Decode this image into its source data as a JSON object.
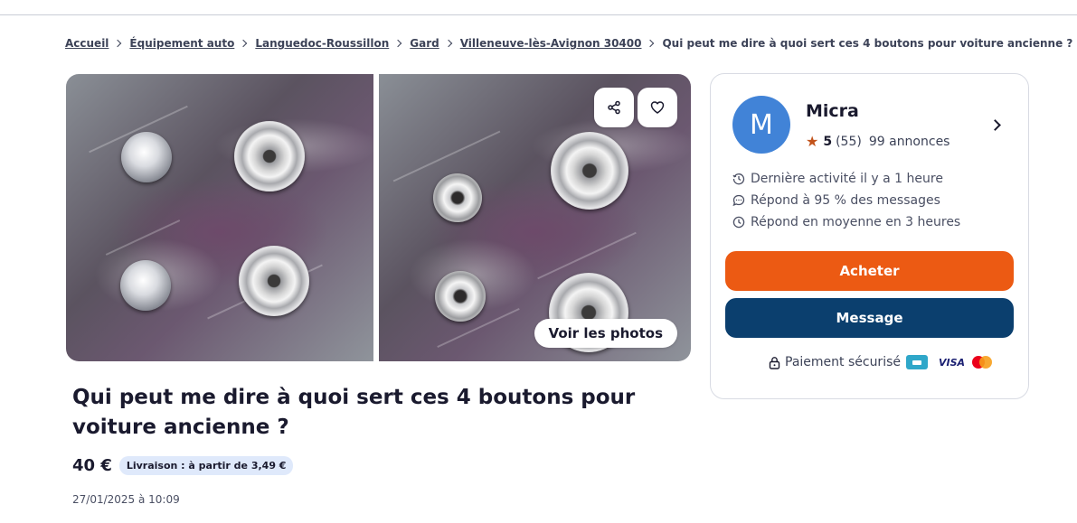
{
  "breadcrumb": {
    "items": [
      "Accueil",
      "Équipement auto",
      "Languedoc-Roussillon",
      "Gard",
      "Villeneuve-lès-Avignon 30400"
    ],
    "current": "Qui peut me dire à quoi sert ces 4 boutons pour voiture ancienne ?"
  },
  "gallery": {
    "see_photos_label": "Voir les photos",
    "share_icon": "share-icon",
    "favorite_icon": "heart-icon"
  },
  "listing": {
    "title": "Qui peut me dire à quoi sert ces 4 boutons pour voiture ancienne ?",
    "price": "40 €",
    "delivery": "Livraison : à partir de 3,49 €",
    "date": "27/01/2025 à 10:09"
  },
  "seller": {
    "avatar_letter": "M",
    "name": "Micra",
    "rating": "5",
    "reviews": "(55)",
    "listings": "99 annonces",
    "last_activity": "Dernière activité il y a 1 heure",
    "response_rate": "Répond à 95 % des messages",
    "response_time": "Répond en moyenne en 3 heures"
  },
  "actions": {
    "buy_label": "Acheter",
    "message_label": "Message"
  },
  "payment": {
    "label": "Paiement sécurisé",
    "visa_text": "VISA"
  },
  "colors": {
    "buy": "#ec5a13",
    "message": "#0b3f6e",
    "avatar": "#4183d7",
    "star": "#c2531b"
  }
}
